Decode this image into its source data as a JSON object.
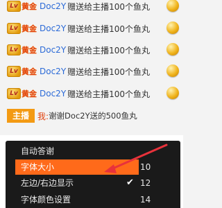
{
  "gifts": [
    {
      "level": "Lv",
      "tier": "黄金",
      "user": "Doc2Y",
      "text": "赠送给主播100个鱼丸"
    },
    {
      "level": "Lv",
      "tier": "黄金",
      "user": "Doc2Y",
      "text": "赠送给主播100个鱼丸"
    },
    {
      "level": "Lv",
      "tier": "黄金",
      "user": "Doc2Y",
      "text": "赠送给主播100个鱼丸"
    },
    {
      "level": "Lv",
      "tier": "黄金",
      "user": "Doc2Y",
      "text": "赠送给主播100个鱼丸"
    },
    {
      "level": "Lv",
      "tier": "黄金",
      "user": "Doc2Y",
      "text": "赠送给主播100个鱼丸"
    }
  ],
  "host_message": {
    "badge": "主播",
    "name": "我:",
    "text": "谢谢Doc2Y送的500鱼丸"
  },
  "menu": {
    "items": [
      {
        "label": "自动答谢",
        "value": ""
      },
      {
        "label": "字体大小",
        "value": "10",
        "active": true
      },
      {
        "label": "左边/右边显示",
        "value": "12",
        "checked": true
      },
      {
        "label": "字体颜色设置",
        "value": "14"
      }
    ],
    "check_glyph": "✔"
  },
  "colors": {
    "accent": "#ff6a1a",
    "username": "#2b6ad7",
    "host_badge": "#f39a13"
  }
}
